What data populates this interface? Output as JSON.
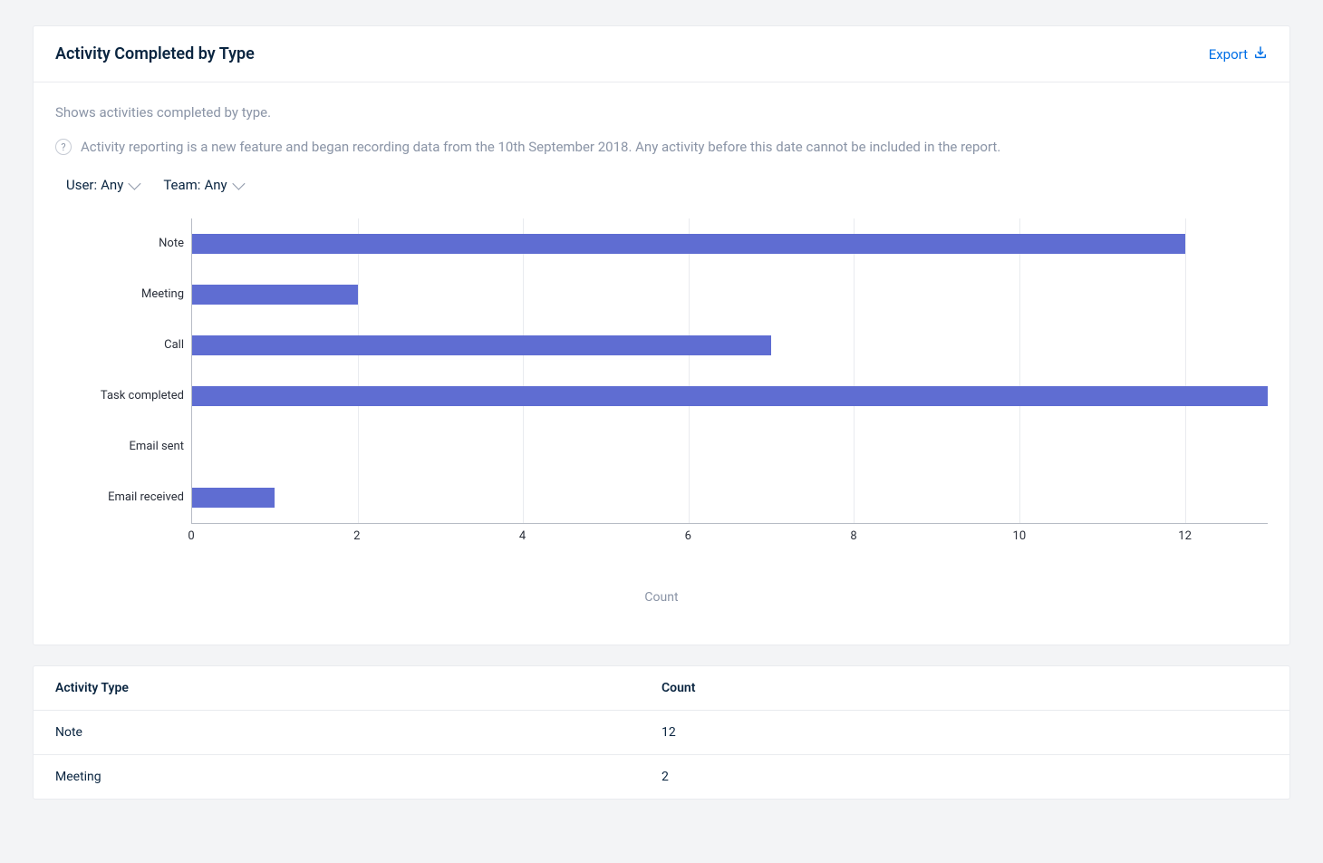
{
  "header": {
    "title": "Activity Completed by Type",
    "export_label": "Export"
  },
  "subtitle": "Shows activities completed by type.",
  "info_text": "Activity reporting is a new feature and began recording data from the 10th September 2018. Any activity before this date cannot be included in the report.",
  "filters": {
    "user_label": "User:",
    "user_value": "Any",
    "team_label": "Team:",
    "team_value": "Any"
  },
  "chart_data": {
    "type": "bar",
    "orientation": "horizontal",
    "categories": [
      "Note",
      "Meeting",
      "Call",
      "Task completed",
      "Email sent",
      "Email received"
    ],
    "values": [
      12,
      2,
      7,
      13,
      0,
      1
    ],
    "xlabel": "Count",
    "x_ticks": [
      0,
      2,
      4,
      6,
      8,
      10,
      12
    ],
    "x_max": 13,
    "bar_color": "#5f6dd2"
  },
  "table": {
    "headers": [
      "Activity Type",
      "Count"
    ],
    "rows": [
      {
        "type": "Note",
        "count": "12"
      },
      {
        "type": "Meeting",
        "count": "2"
      }
    ]
  }
}
